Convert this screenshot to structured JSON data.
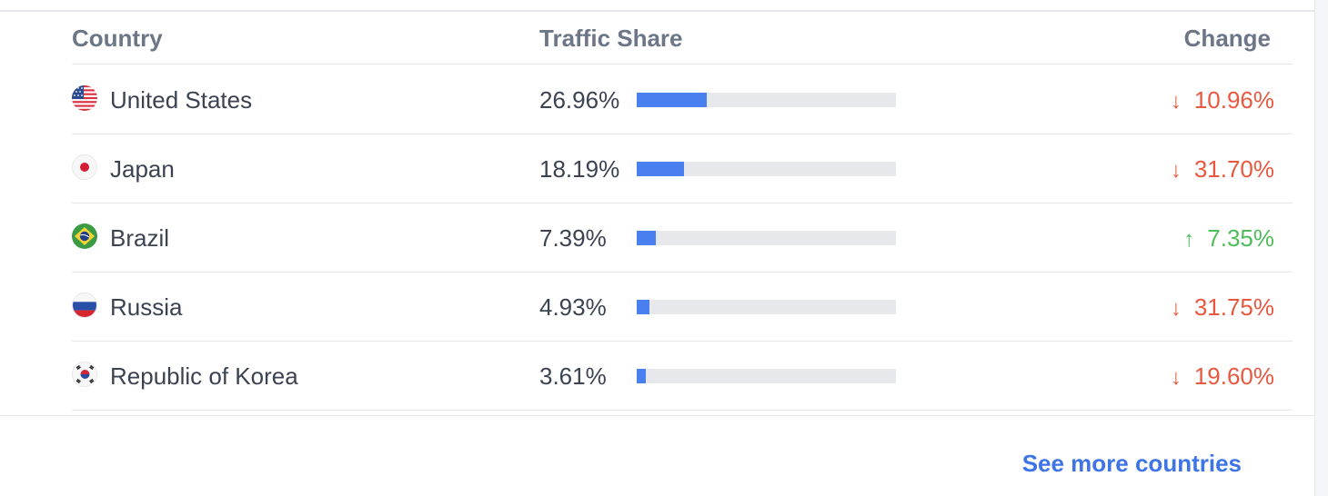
{
  "table": {
    "headers": {
      "country": "Country",
      "traffic_share": "Traffic Share",
      "change": "Change"
    },
    "rows": [
      {
        "flag": "us-flag-icon",
        "country": "United States",
        "share": "26.96%",
        "share_value": 26.96,
        "change": "10.96%",
        "direction": "down",
        "arrow": "↓"
      },
      {
        "flag": "jp-flag-icon",
        "country": "Japan",
        "share": "18.19%",
        "share_value": 18.19,
        "change": "31.70%",
        "direction": "down",
        "arrow": "↓"
      },
      {
        "flag": "br-flag-icon",
        "country": "Brazil",
        "share": "7.39%",
        "share_value": 7.39,
        "change": "7.35%",
        "direction": "up",
        "arrow": "↑"
      },
      {
        "flag": "ru-flag-icon",
        "country": "Russia",
        "share": "4.93%",
        "share_value": 4.93,
        "change": "31.75%",
        "direction": "down",
        "arrow": "↓"
      },
      {
        "flag": "kr-flag-icon",
        "country": "Republic of Korea",
        "share": "3.61%",
        "share_value": 3.61,
        "change": "19.60%",
        "direction": "down",
        "arrow": "↓"
      }
    ]
  },
  "footer": {
    "see_more_label": "See more countries"
  },
  "colors": {
    "bar_fill": "#4a7ff0",
    "bar_track": "#e6e8ec",
    "down": "#e8583f",
    "up": "#4dbd5a",
    "link": "#3f74e6"
  }
}
